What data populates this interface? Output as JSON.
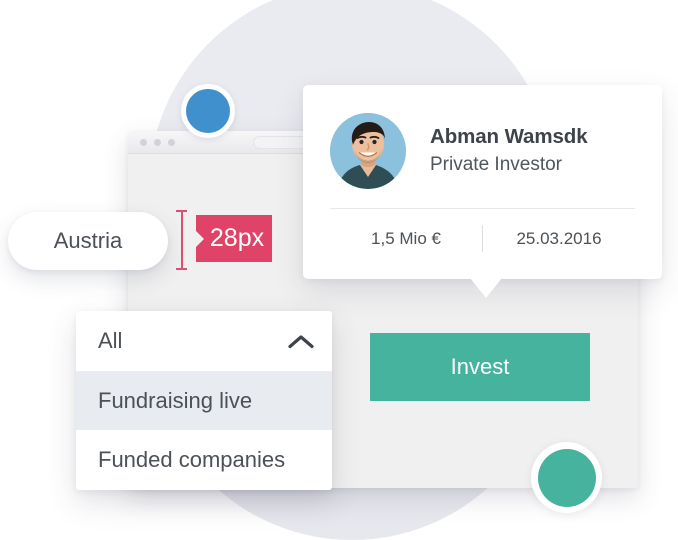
{
  "theme": {
    "accent_teal": "#45b39d",
    "accent_pink": "#e04368",
    "accent_blue": "#4190ce",
    "backdrop": "#eaebf0",
    "browser_body": "#f0f0f0",
    "text": "#4b5157"
  },
  "browser": {
    "window_name": "browser-window",
    "dots": [
      "dot-1",
      "dot-2",
      "dot-3"
    ],
    "address_bar_value": ""
  },
  "decor": {
    "blue_circle_icon": "blue-circle",
    "teal_circle_icon": "teal-circle",
    "backdrop_circle_icon": "backdrop-circle"
  },
  "investor_card": {
    "avatar_alt": "avatar-photo",
    "name": "Abman Wamsdk",
    "role": "Private Investor",
    "stats": [
      {
        "key": "amount",
        "value": "1,5 Mio €"
      },
      {
        "key": "date",
        "value": "25.03.2016"
      }
    ]
  },
  "invest_button": {
    "label": "Invest"
  },
  "location_pill": {
    "label": "Austria"
  },
  "measurement": {
    "value": "28px",
    "bar_icon": "measure-bar-icon",
    "notch_icon": "callout-notch-icon"
  },
  "dropdown": {
    "selected_label": "All",
    "chevron_icon": "chevron-up-icon",
    "options": [
      {
        "label": "Fundraising live",
        "selected": true
      },
      {
        "label": "Funded companies",
        "selected": false
      }
    ]
  }
}
